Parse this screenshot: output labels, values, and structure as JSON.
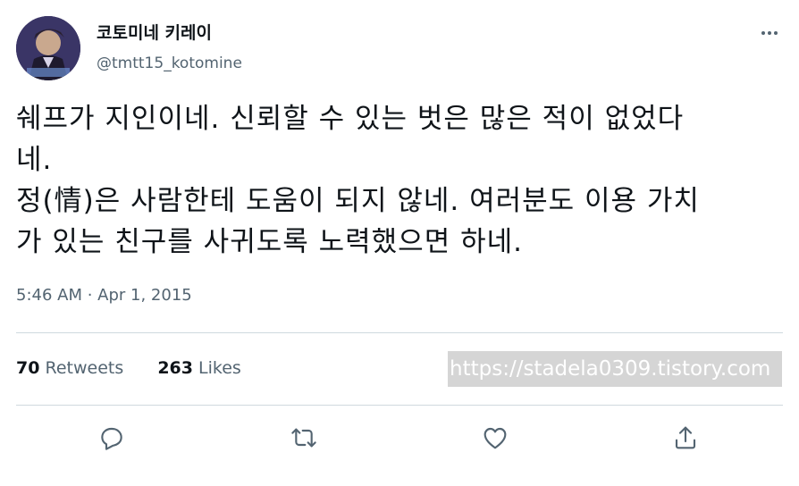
{
  "tweet": {
    "display_name": "코토미네 키레이",
    "handle": "@tmtt15_kotomine",
    "lines": [
      "쉐프가 지인이네. 신뢰할 수 있는 벗은 많은 적이 없었다",
      "네.",
      "정(情)은 사람한테 도움이 되지 않네. 여러분도 이용 가치",
      "가 있는 친구를 사귀도록 노력했으면 하네."
    ],
    "timestamp": "5:46 AM · Apr 1, 2015",
    "retweets": {
      "count": "70",
      "label": "Retweets"
    },
    "likes": {
      "count": "263",
      "label": "Likes"
    }
  },
  "watermark": "https://stadela0309.tistory.com",
  "icons": {
    "more": "more-horizontal-icon",
    "reply": "reply-icon",
    "retweet": "retweet-icon",
    "like": "heart-icon",
    "share": "share-icon"
  },
  "colors": {
    "text": "#0f1419",
    "secondary": "#536471",
    "divider": "#cfd9de",
    "watermark_bg": "#d5d5d5"
  }
}
